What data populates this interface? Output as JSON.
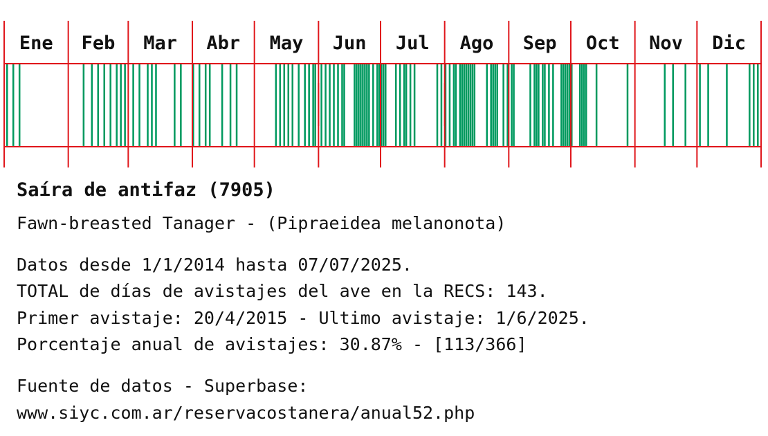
{
  "chart_data": {
    "type": "bar",
    "description_type": "annual sighting strip (barcode) by day of year",
    "months": [
      "Ene",
      "Feb",
      "Mar",
      "Abr",
      "May",
      "Jun",
      "Jul",
      "Ago",
      "Sep",
      "Oct",
      "Nov",
      "Dic"
    ],
    "month_days": [
      31,
      29,
      31,
      30,
      31,
      30,
      31,
      31,
      30,
      31,
      30,
      31
    ],
    "sighting_days_of_year": [
      2,
      5,
      8,
      39,
      43,
      46,
      49,
      52,
      55,
      57,
      59,
      63,
      66,
      70,
      72,
      74,
      83,
      86,
      92,
      95,
      98,
      100,
      106,
      110,
      113,
      132,
      134,
      136,
      138,
      140,
      143,
      146,
      148,
      150,
      151,
      154,
      156,
      158,
      160,
      162,
      164,
      165,
      170,
      171,
      172,
      173,
      174,
      175,
      176,
      177,
      179,
      181,
      182,
      183,
      184,
      185,
      190,
      192,
      194,
      195,
      197,
      199,
      210,
      212,
      214,
      216,
      218,
      219,
      221,
      222,
      223,
      224,
      225,
      226,
      227,
      228,
      234,
      236,
      237,
      238,
      239,
      242,
      244,
      246,
      247,
      255,
      257,
      258,
      259,
      261,
      262,
      264,
      266,
      270,
      271,
      272,
      273,
      274,
      275,
      279,
      280,
      281,
      282,
      287,
      302,
      320,
      324,
      330,
      337,
      341,
      350,
      361,
      363,
      365
    ],
    "bar_color": "#00995f",
    "grid_color": "#e0161b"
  },
  "text": {
    "species": "Saíra de antifaz (7905)",
    "common": "Fawn-breasted Tanager - (Pipraeidea melanonota)",
    "range": "Datos desde 1/1/2014 hasta 07/07/2025.",
    "total": "TOTAL de días de avistajes del ave en la RECS: 143.",
    "dates": "Primer avistaje: 20/4/2015 - Ultimo avistaje: 1/6/2025.",
    "pct": "Porcentaje anual de avistajes: 30.87% - [113/366]",
    "src_label": "Fuente de datos - Superbase:",
    "src_url": "www.siyc.com.ar/reservacostanera/anual52.php"
  }
}
